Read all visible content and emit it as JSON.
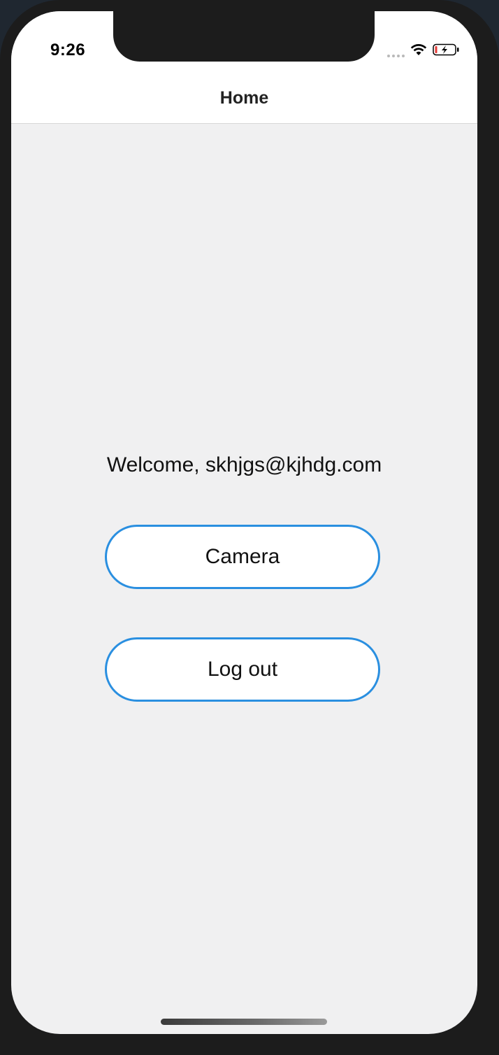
{
  "status_bar": {
    "time": "9:26",
    "icons": [
      "signal-dots-icon",
      "wifi-icon",
      "battery-charging-icon"
    ],
    "battery_low_color": "#e53935"
  },
  "nav": {
    "title": "Home"
  },
  "main": {
    "welcome_text": "Welcome, skhjgs@kjhdg.com",
    "camera_button_label": "Camera",
    "logout_button_label": "Log out"
  },
  "colors": {
    "accent": "#2a8fe0",
    "screen_background": "#f0f0f1",
    "bar_background": "#ffffff",
    "frame": "#1c1c1c"
  }
}
